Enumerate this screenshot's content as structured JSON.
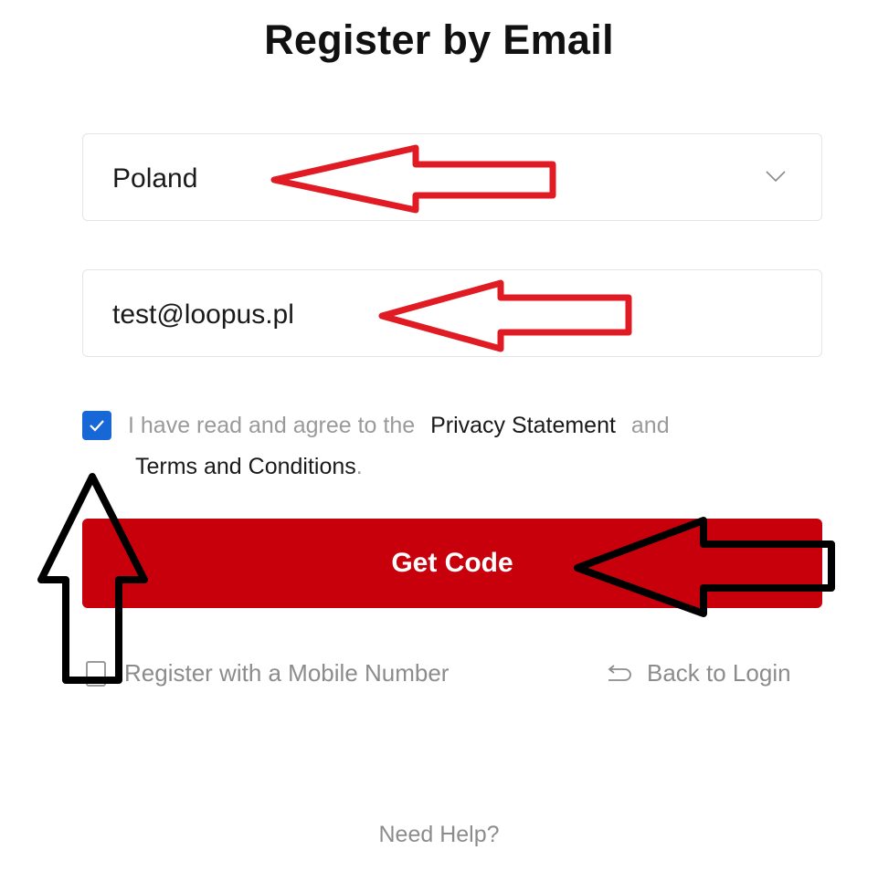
{
  "title": "Register by Email",
  "country": {
    "value": "Poland"
  },
  "email": {
    "value": "test@loopus.pl"
  },
  "agreement": {
    "checked": true,
    "prefix": "I have read and agree to the",
    "privacy_link": "Privacy Statement",
    "and": "and",
    "terms_link": "Terms and Conditions",
    "suffix": "."
  },
  "actions": {
    "get_code": "Get Code",
    "mobile_link": "Register with a Mobile Number",
    "back_link": "Back to Login"
  },
  "footer": {
    "help": "Need Help?"
  },
  "colors": {
    "primary_button": "#c8000b",
    "checkbox": "#1767d6",
    "annotation_red": "#e01b24",
    "annotation_black": "#000000"
  },
  "icons": [
    "chevron-down-icon",
    "check-icon",
    "phone-icon",
    "return-arrow-icon"
  ]
}
